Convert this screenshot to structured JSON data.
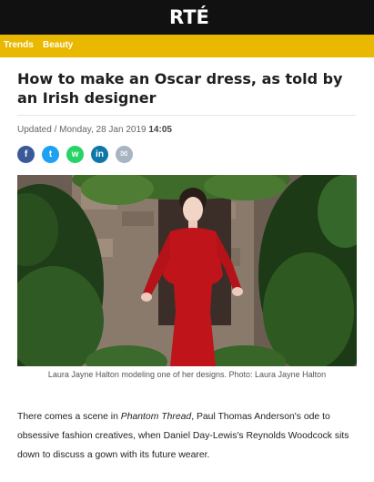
{
  "header": {
    "logo_text": "RTÉ",
    "bg_color": "#111111"
  },
  "nav": {
    "items": [
      "Trends",
      "Beauty"
    ],
    "bg_color": "#e8b900"
  },
  "article": {
    "headline": "How to make an Oscar dress, as told by an Irish designer",
    "updated_prefix": "Updated / Monday, 28 Jan 2019",
    "updated_time": "14:05",
    "share": [
      {
        "icon": "facebook-icon",
        "glyph": "f",
        "color": "#3b5998"
      },
      {
        "icon": "twitter-icon",
        "glyph": "t",
        "color": "#1da1f2"
      },
      {
        "icon": "whatsapp-icon",
        "glyph": "w",
        "color": "#25d366"
      },
      {
        "icon": "linkedin-icon",
        "glyph": "in",
        "color": "#0e76a8"
      },
      {
        "icon": "email-icon",
        "glyph": "✉",
        "color": "#a9b4c2"
      }
    ],
    "image_caption": "Laura Jayne Halton modeling one of her designs. Photo: Laura Jayne Halton",
    "paragraph": {
      "part1": "There comes a scene in ",
      "film": "Phantom Thread",
      "part2": ", Paul Thomas Anderson's ode to obsessive fashion creatives, when Daniel Day-Lewis's Reynolds Woodcock sits down to discuss a gown with its future wearer."
    }
  }
}
